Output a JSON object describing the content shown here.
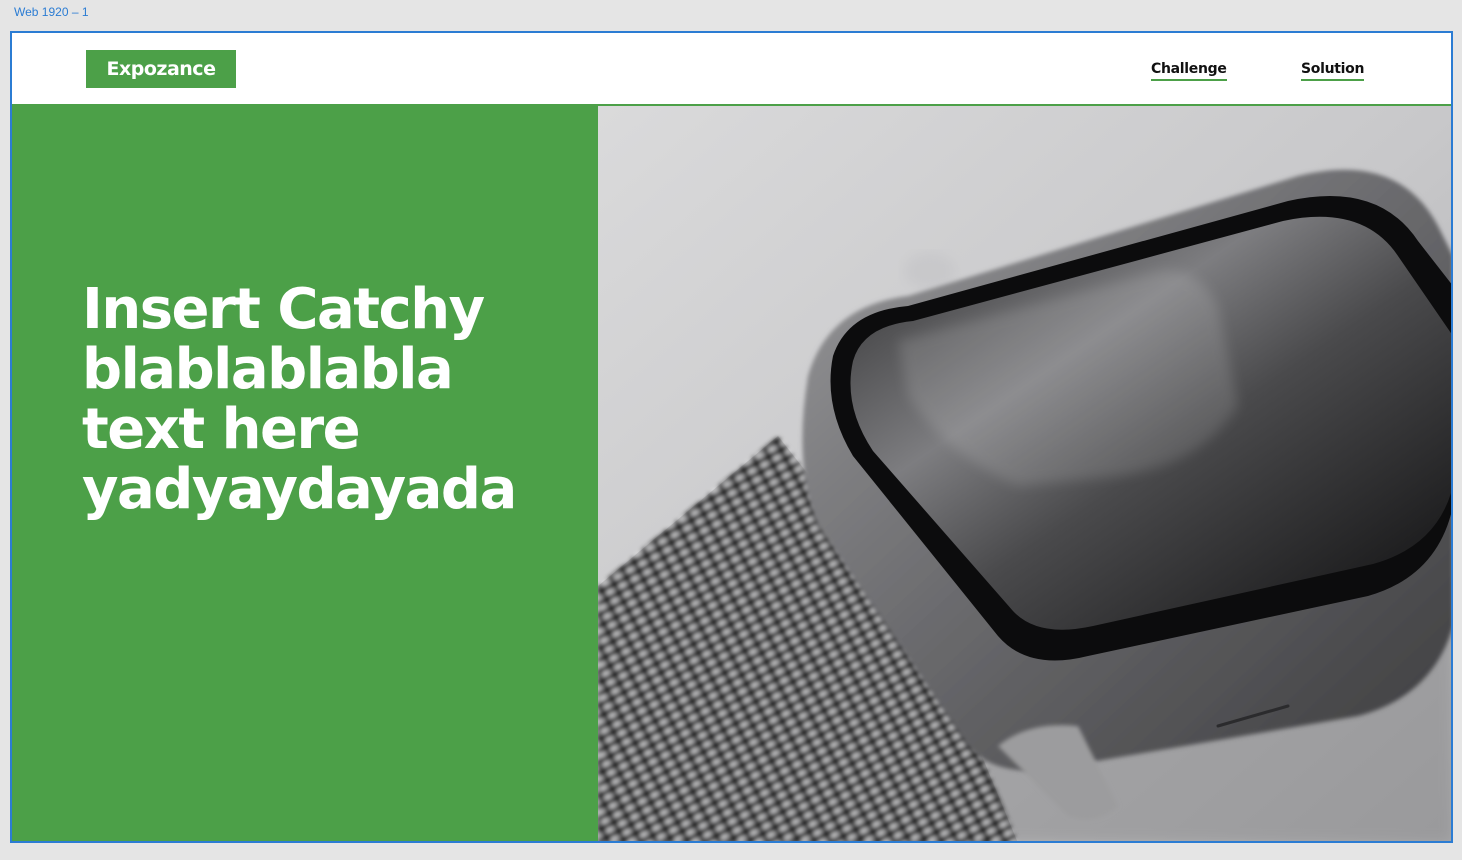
{
  "artboard": {
    "label": "Web 1920 – 1"
  },
  "header": {
    "logo": "Expozance",
    "nav": [
      {
        "label": "Challenge"
      },
      {
        "label": "Solution"
      }
    ]
  },
  "hero": {
    "title_lines": [
      "Insert Catchy",
      "blablablabla",
      "text here",
      "yadyaydayada"
    ],
    "image": {
      "subject": "smartwatch with milanese mesh band",
      "style": "grayscale photo"
    }
  },
  "colors": {
    "brand_green": "#4ca048",
    "artboard_border": "#2b7cd3",
    "canvas": "#e5e5e5"
  }
}
